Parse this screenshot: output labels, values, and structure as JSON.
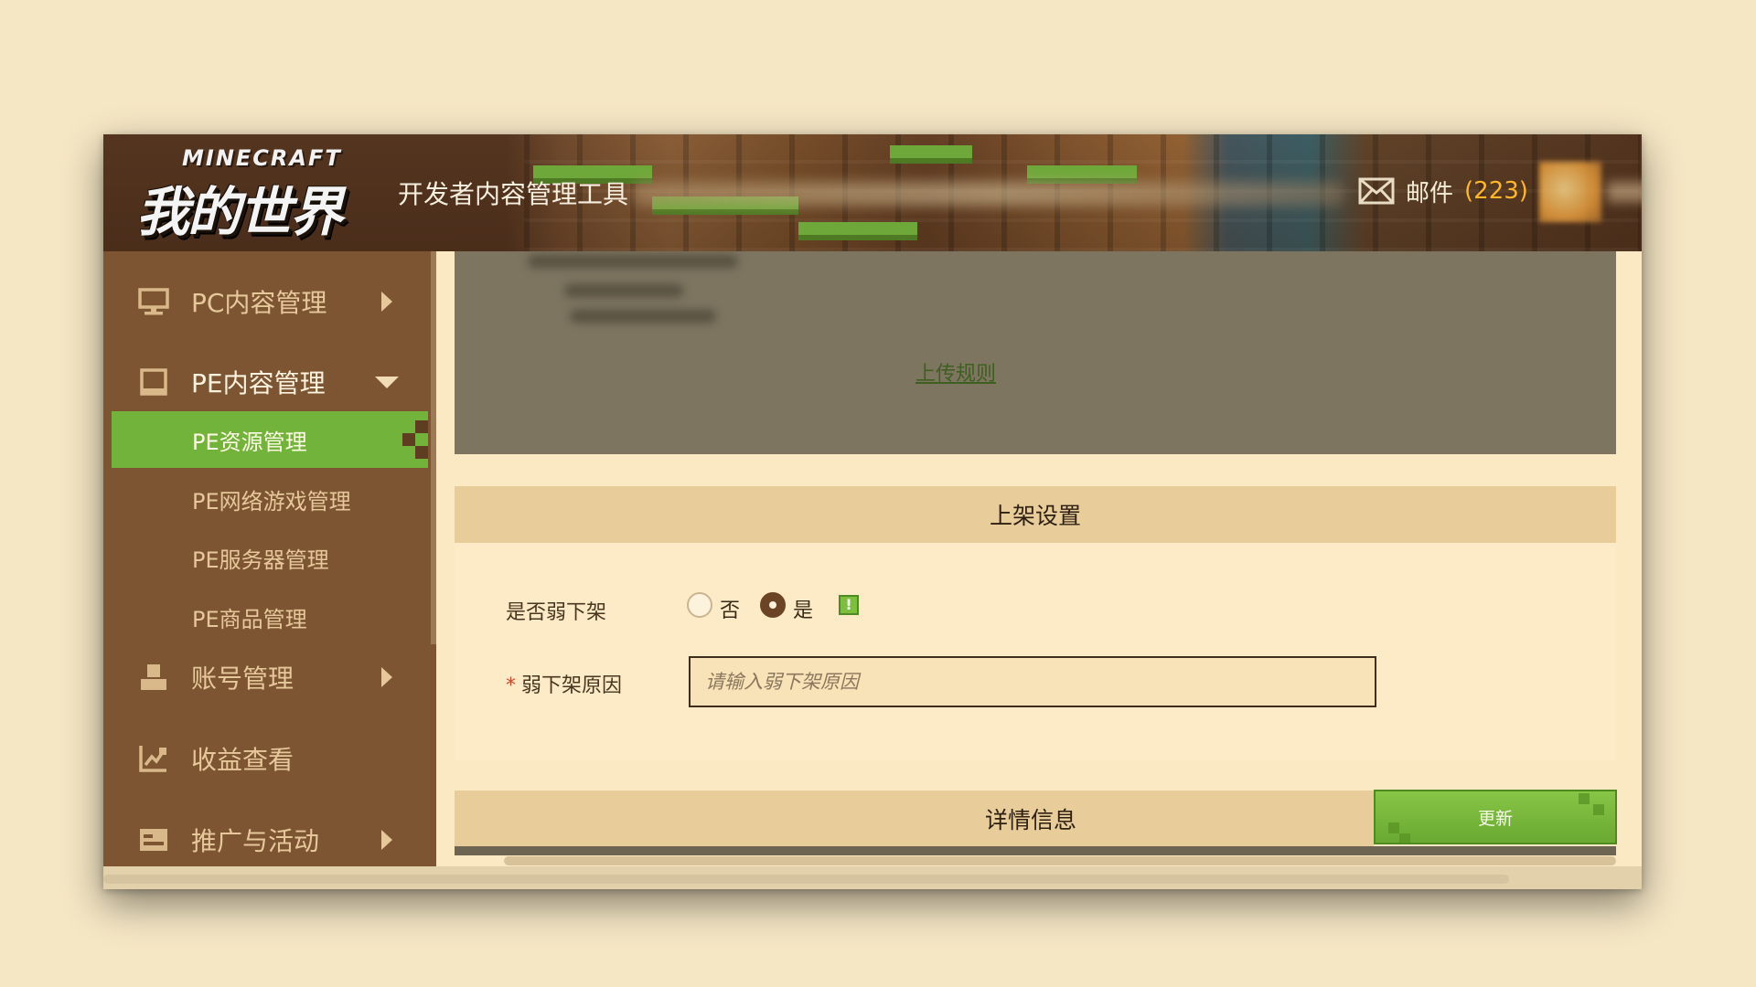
{
  "header": {
    "logo_top": "MINECRAFT",
    "logo_main": "我的世界",
    "app_title": "开发者内容管理工具",
    "mail_label": "邮件",
    "mail_count": "(223)"
  },
  "sidebar": {
    "items": [
      {
        "label": "PC内容管理",
        "icon": "monitor-icon",
        "arrow": "right"
      },
      {
        "label": "PE内容管理",
        "icon": "tablet-icon",
        "arrow": "down"
      },
      {
        "label": "账号管理",
        "icon": "user-icon",
        "arrow": "right"
      },
      {
        "label": "收益查看",
        "icon": "chart-icon",
        "arrow": "none"
      },
      {
        "label": "推广与活动",
        "icon": "promotion-icon",
        "arrow": "right"
      }
    ],
    "sub_items": [
      {
        "label": "PE资源管理",
        "active": true
      },
      {
        "label": "PE网络游戏管理",
        "active": false
      },
      {
        "label": "PE服务器管理",
        "active": false
      },
      {
        "label": "PE商品管理",
        "active": false
      }
    ]
  },
  "main": {
    "upload_rules_link": "上传规则",
    "listing_section": {
      "title": "上架设置",
      "weak_delist_label": "是否弱下架",
      "options": [
        "否",
        "是"
      ],
      "selected": "是",
      "reason_label": "弱下架原因",
      "reason_required_mark": "*",
      "reason_placeholder": "请输入弱下架原因",
      "reason_value": ""
    },
    "details_section": {
      "title": "详情信息"
    },
    "update_button": "更新"
  },
  "colors": {
    "accent_green": "#72b43b",
    "sidebar_brown": "#7d5532",
    "mail_count_orange": "#ffb627"
  }
}
